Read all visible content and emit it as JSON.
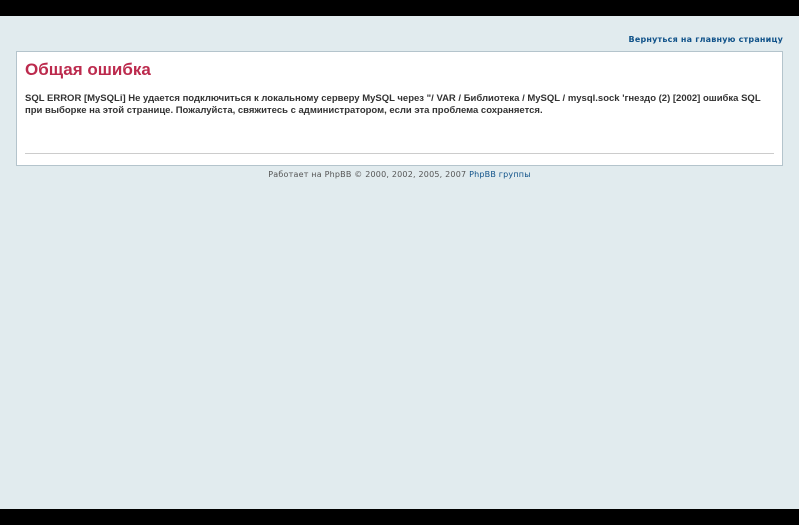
{
  "header": {
    "back_link": "Вернуться на главную страницу"
  },
  "error_panel": {
    "title": "Общая ошибка",
    "message": "SQL ERROR [MySQLi] Не удается подключиться к локальному серверу MySQL через \"/ VAR / Библиотека / MySQL / mysql.sock 'гнездо (2) [2002] ошибка SQL при выборке на этой странице. Пожалуйста, свяжитесь с администратором, если эта проблема сохраняется."
  },
  "footer": {
    "powered_by_text": "Работает на PhpBB © 2000, 2002, 2005, 2007",
    "group_link": "PhpBB группы"
  },
  "colors": {
    "background": "#e1ebee",
    "title": "#bc2a4d",
    "link": "#105289"
  }
}
